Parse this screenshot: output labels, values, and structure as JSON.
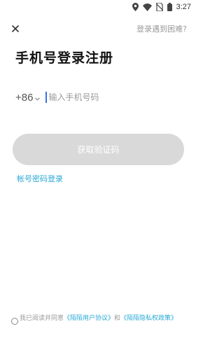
{
  "status_bar": {
    "time": "3:27",
    "icons": [
      "location-icon",
      "wifi-icon",
      "no-sim-icon",
      "battery-icon"
    ]
  },
  "header": {
    "close_icon": "close-icon",
    "trouble_label": "登录遇到困难?"
  },
  "title": "手机号登录注册",
  "phone": {
    "country_code": "+86",
    "placeholder": "输入手机号码",
    "value": ""
  },
  "get_code_button": "获取验证码",
  "password_login_link": "帐号密码登录",
  "agreement": {
    "prefix": "我已阅读并同意",
    "user_agreement": "《陌陌用户协议》",
    "conjunction": "和",
    "privacy_policy": "《陌陌隐私权政策》",
    "checked": false
  },
  "colors": {
    "accent": "#2aa9d6",
    "caret": "#3b6ee8",
    "button_disabled": "#d9d9d9",
    "muted_text": "#9a9a9a"
  }
}
